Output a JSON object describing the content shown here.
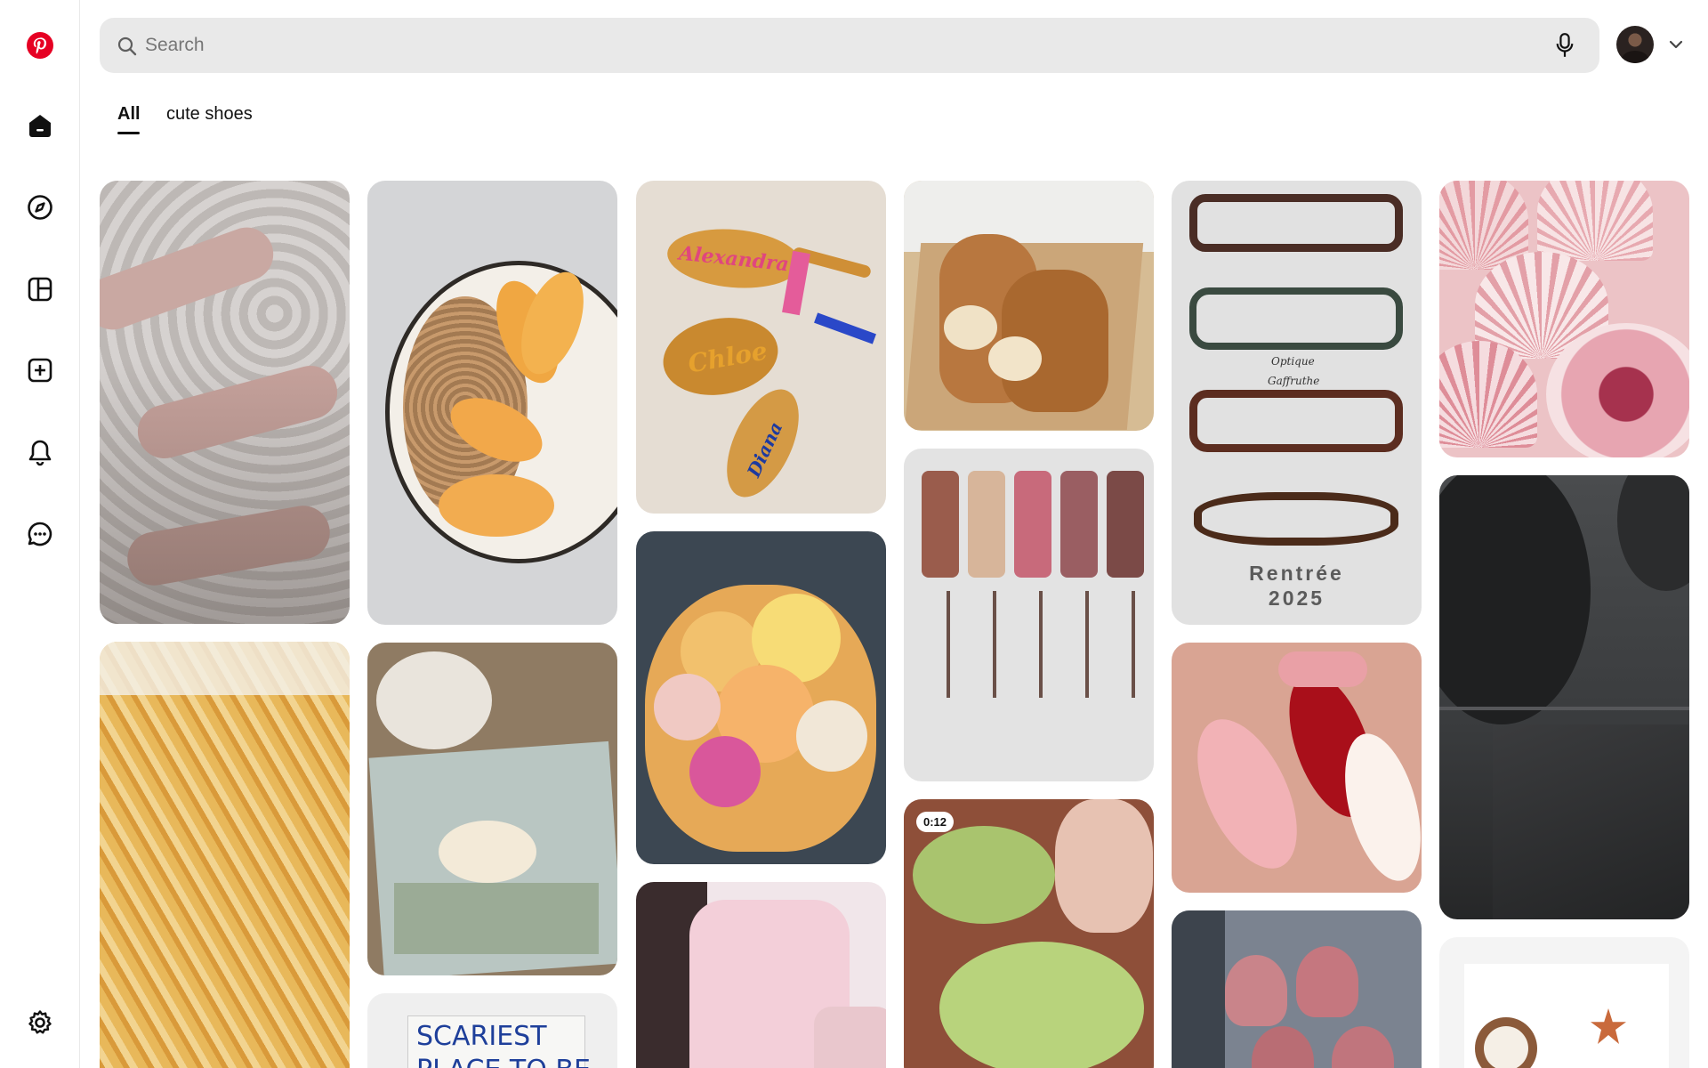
{
  "search": {
    "placeholder": "Search"
  },
  "tabs": {
    "all": "All",
    "query": "cute shoes"
  },
  "sidebar": {
    "items": [
      "pinterest-logo",
      "home-icon",
      "explore-icon",
      "boards-icon",
      "create-icon",
      "notifications-icon",
      "messages-icon",
      "settings-icon"
    ]
  },
  "pins": {
    "video_duration": "0:12",
    "hairbrush_names": [
      "Alexandra",
      "Chloe",
      "Diana"
    ],
    "glasses_brand": [
      "Optique",
      "Gaffruthe"
    ],
    "glasses_caption": {
      "line1": "Rentrée",
      "line2": "2025"
    },
    "board_text": "SCARIEST PLACE TO BE"
  },
  "colors": {
    "brand": "#e60023",
    "search_bg": "#e9e9e9",
    "active_tab": "#111111"
  }
}
